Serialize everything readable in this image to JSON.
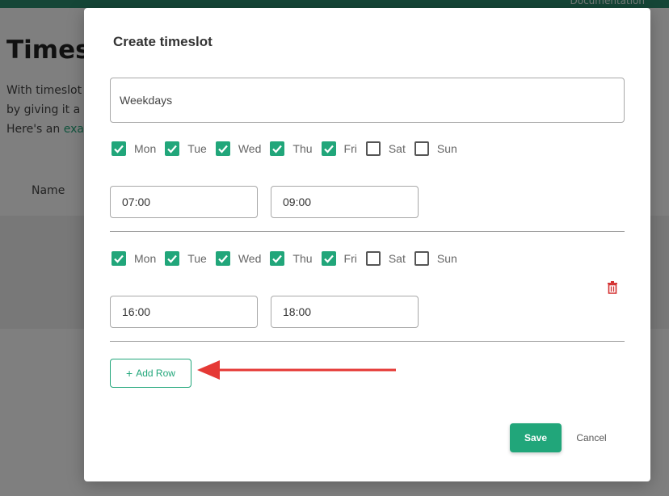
{
  "background": {
    "header_link": "Documentation",
    "title": "Timesl",
    "lines": [
      "With timeslot",
      "by giving it a",
      "Here's an "
    ],
    "link_text": "exa",
    "column_header": "Name"
  },
  "modal": {
    "title": "Create timeslot",
    "name_value": "Weekdays",
    "rows": [
      {
        "days": [
          {
            "label": "Mon",
            "checked": true
          },
          {
            "label": "Tue",
            "checked": true
          },
          {
            "label": "Wed",
            "checked": true
          },
          {
            "label": "Thu",
            "checked": true
          },
          {
            "label": "Fri",
            "checked": true
          },
          {
            "label": "Sat",
            "checked": false
          },
          {
            "label": "Sun",
            "checked": false
          }
        ],
        "start": "07:00",
        "end": "09:00"
      },
      {
        "days": [
          {
            "label": "Mon",
            "checked": true
          },
          {
            "label": "Tue",
            "checked": true
          },
          {
            "label": "Wed",
            "checked": true
          },
          {
            "label": "Thu",
            "checked": true
          },
          {
            "label": "Fri",
            "checked": true
          },
          {
            "label": "Sat",
            "checked": false
          },
          {
            "label": "Sun",
            "checked": false
          }
        ],
        "start": "16:00",
        "end": "18:00"
      }
    ],
    "add_row_label": "Add Row",
    "save_label": "Save",
    "cancel_label": "Cancel"
  },
  "colors": {
    "accent": "#21a67a",
    "header": "#2a8c6e",
    "arrow": "#e53935",
    "delete": "#d32f2f"
  },
  "icons": {
    "add": "plus-icon",
    "delete": "trash-icon",
    "annotation": "arrow-icon",
    "check": "checkmark-icon"
  }
}
